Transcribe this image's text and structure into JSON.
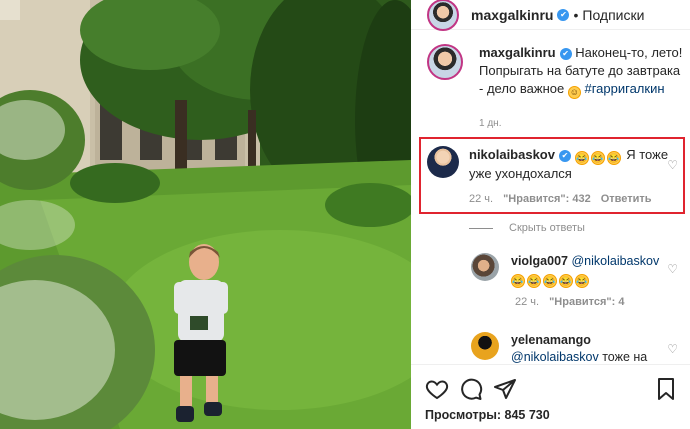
{
  "header": {
    "username": "maxgalkinru",
    "verified_mark": "✔",
    "separator": "•",
    "follow_label": "Подписки"
  },
  "caption": {
    "username": "maxgalkinru",
    "verified_mark": "✔",
    "text": "Наконец-то, лето! Попрыгать на батуте до завтрака - дело важное",
    "hashtag": "#гарригалкин",
    "time": "1 дн."
  },
  "comment": {
    "username": "nikolaibaskov",
    "verified_mark": "✔",
    "text": "Я тоже уже ухондохался",
    "time": "22 ч.",
    "likes": "\"Нравится\": 432",
    "reply_label": "Ответить"
  },
  "hide_replies_label": "Скрыть ответы",
  "replies": [
    {
      "username": "violga007",
      "mention": "@nikolaibaskov",
      "time": "22 ч.",
      "likes": "\"Нравится\": 4"
    },
    {
      "username": "yelenamango",
      "mention": "@nikolaibaskov",
      "text": "тоже на"
    }
  ],
  "actions": {
    "icons": [
      "heart-icon",
      "comment-icon",
      "share-icon",
      "bookmark-icon"
    ]
  },
  "views": "Просмотры: 845 730",
  "colors": {
    "highlight": "#e0242f",
    "verified": "#3897f0",
    "link": "#00376b",
    "muted": "#8e8e8e"
  }
}
